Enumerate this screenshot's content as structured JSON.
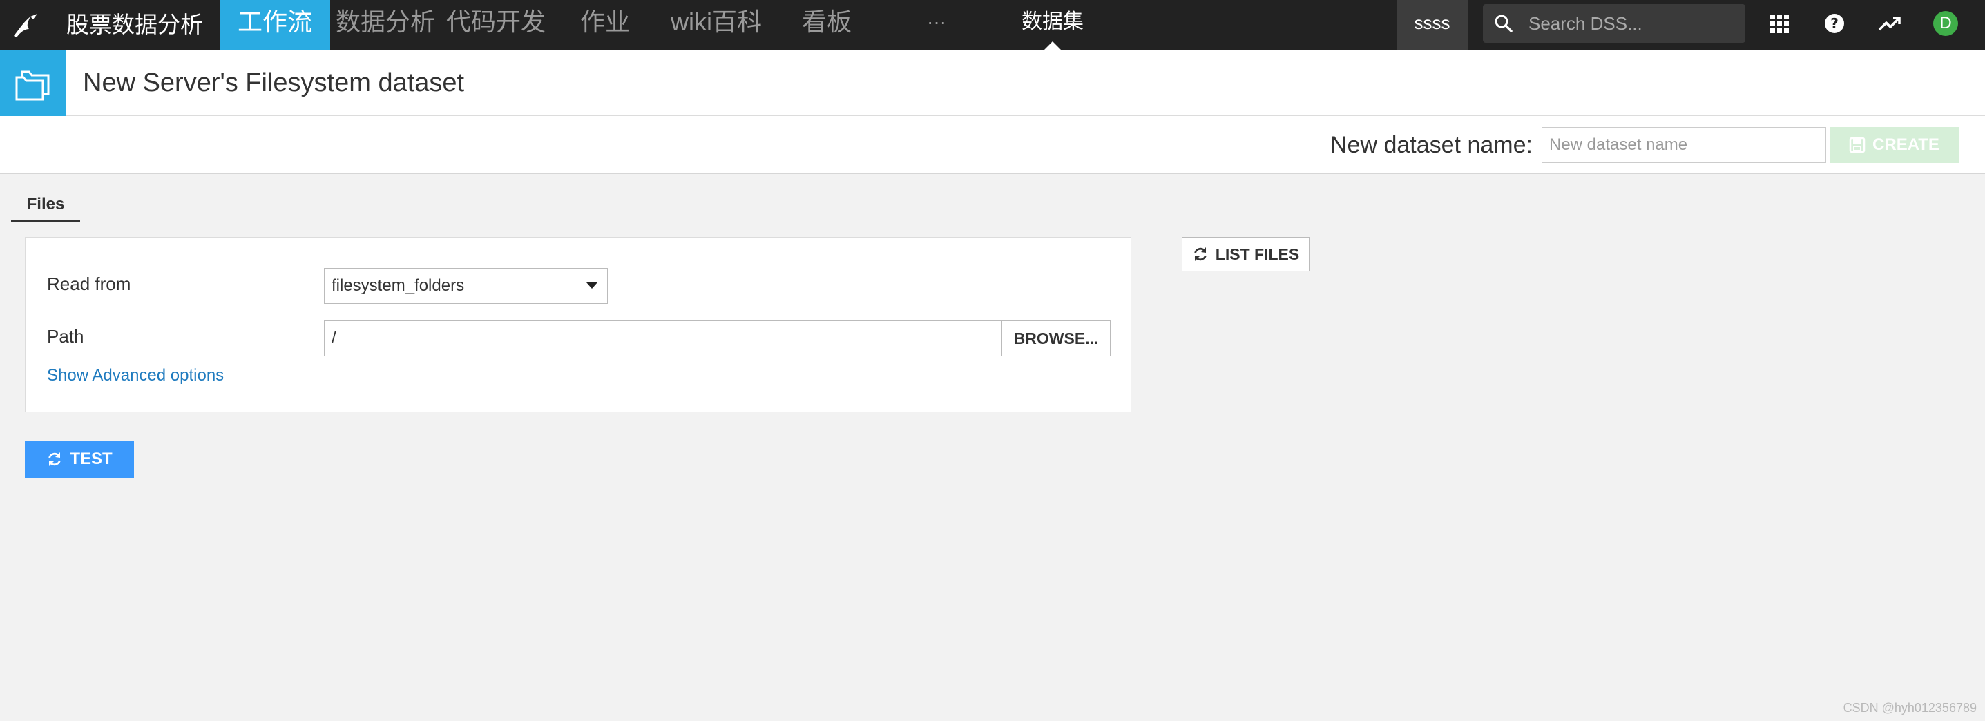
{
  "topbar": {
    "project_name": "股票数据分析",
    "nav": [
      {
        "label": "工作流"
      },
      {
        "label": "数据分析"
      },
      {
        "label": "代码开发"
      },
      {
        "label": "作业"
      },
      {
        "label": "wiki百科"
      },
      {
        "label": "看板"
      },
      {
        "label": "···"
      }
    ],
    "current_section": "数据集",
    "user_tag": "ssss",
    "search_placeholder": "Search DSS...",
    "avatar_initial": "D",
    "avatar_color": "#3fae49",
    "accent_color": "#2aabe2"
  },
  "header": {
    "title": "New Server's Filesystem dataset",
    "icon": "folder-icon"
  },
  "name_bar": {
    "label": "New dataset name:",
    "input_placeholder": "New dataset name",
    "input_value": "",
    "create_label": "CREATE"
  },
  "tabs": [
    {
      "label": "Files"
    }
  ],
  "form": {
    "read_from_label": "Read from",
    "read_from_value": "filesystem_folders",
    "path_label": "Path",
    "path_value": "/",
    "browse_label": "BROWSE...",
    "advanced_link": "Show Advanced options"
  },
  "actions": {
    "list_files_label": "LIST FILES",
    "test_label": "TEST",
    "test_color": "#3b99fc"
  },
  "watermark": "CSDN @hyh012356789"
}
